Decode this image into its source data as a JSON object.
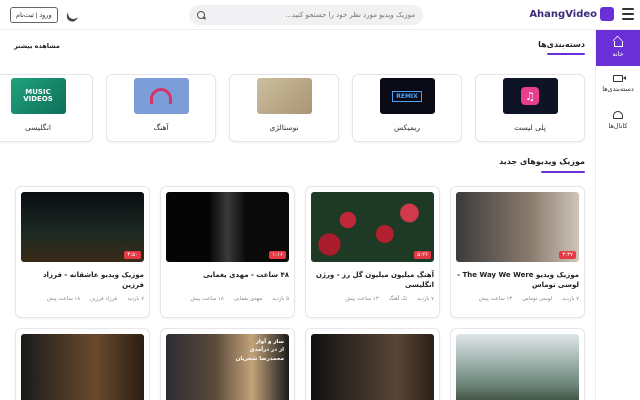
{
  "header": {
    "logo_text": "AhangVideo",
    "search_placeholder": "موزیک ویدیو مورد نظر خود را جستجو کنید...",
    "login_label": "ورود | ثبت‌نام"
  },
  "sidebar": {
    "items": [
      {
        "label": "خانه",
        "icon": "home-icon",
        "active": true
      },
      {
        "label": "دسته‌بندی‌ها",
        "icon": "video-icon",
        "active": false
      },
      {
        "label": "کانال‌ها",
        "icon": "channels-icon",
        "active": false
      }
    ]
  },
  "categories_section": {
    "title": "دسته‌بندی‌ها",
    "see_more": "مشاهده بیشتر",
    "items": [
      {
        "label": "پلی لیست",
        "thumb_text": "♫"
      },
      {
        "label": "ریمیکس",
        "thumb_text": "REMIX"
      },
      {
        "label": "نوستالژی",
        "thumb_text": ""
      },
      {
        "label": "آهنگ",
        "thumb_text": ""
      },
      {
        "label": "انگلیسی",
        "thumb_text": "MUSIC VIDEOS"
      }
    ]
  },
  "videos_section": {
    "title": "موزیک ویدیوهای جدید",
    "videos": [
      {
        "title": "موزیک ویدیو The Way We Were - لوسی توماس",
        "duration": "۳:۳۷",
        "views": "۷ بازدید",
        "artist": "لوسی توماس",
        "time": "۱۳ ساعت پیش"
      },
      {
        "title": "آهنگ میلیون میلیون گل رز - ورژن انگلیسی",
        "duration": "۵:۲۶",
        "views": "۷ بازدید",
        "artist": "تک آهنگ",
        "time": "۱۳ ساعت پیش"
      },
      {
        "title": "۴۸ ساعت - مهدی یغمایی",
        "duration": "۱:۱۶",
        "views": "۵ بازدید",
        "artist": "مهدی یغمایی",
        "time": "۱۸ ساعت پیش"
      },
      {
        "title": "موزیک ویدیو عاشقانه - فرزاد فرزین",
        "duration": "۳:۵۰",
        "views": "۷ بازدید",
        "artist": "فرزاد فرزین",
        "time": "۱۸ ساعت پیش"
      }
    ],
    "row2_thumb_text": "ساز و آواز\nاز در درآمدی\nمحمدرضا شجریان"
  }
}
